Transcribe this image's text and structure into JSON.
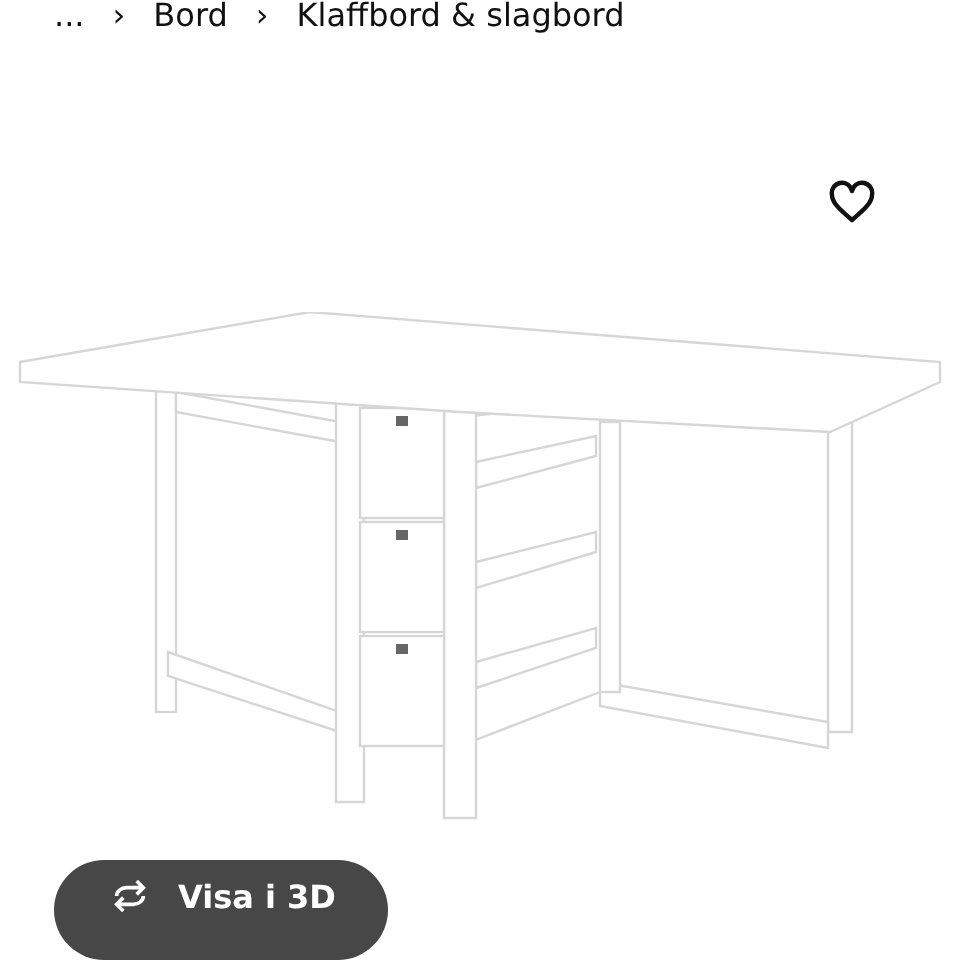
{
  "breadcrumb": [
    {
      "label": "..."
    },
    {
      "label": "Bord"
    },
    {
      "label": "Klaffbord & slagbord"
    }
  ],
  "separator": "›",
  "view_3d_button": {
    "label": "Visa i 3D"
  }
}
